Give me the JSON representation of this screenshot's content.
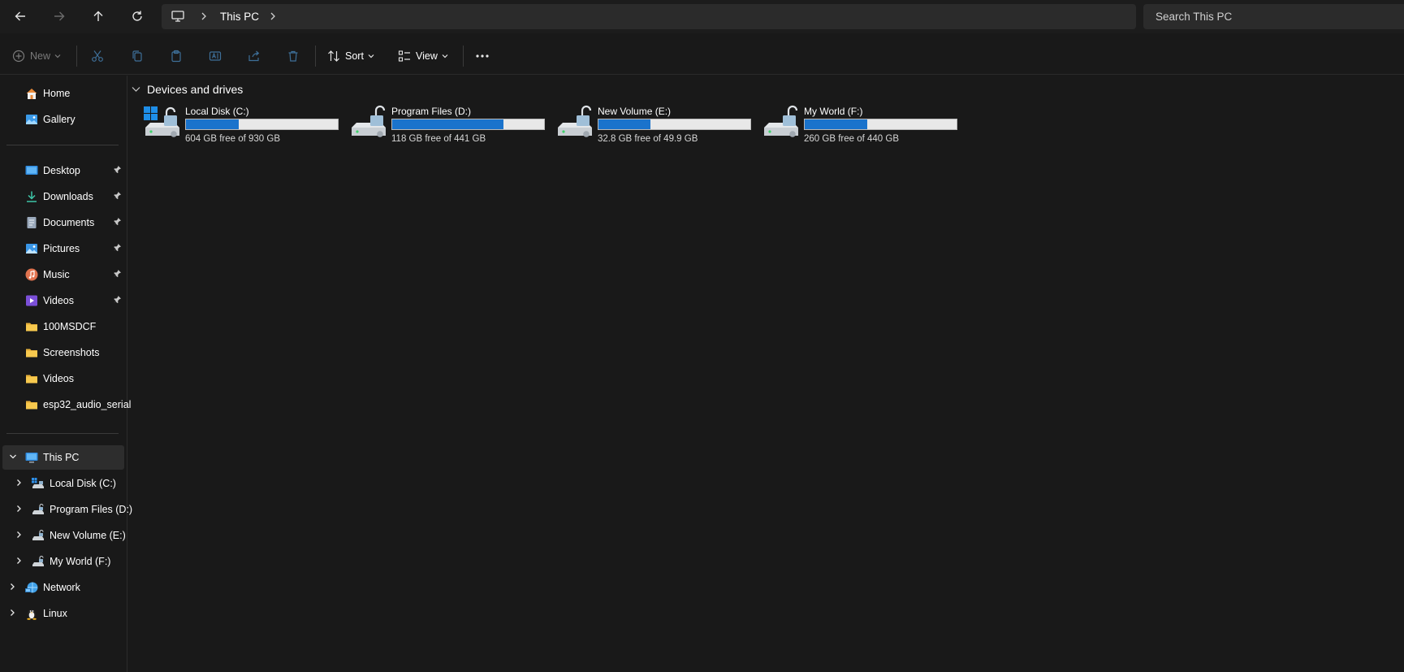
{
  "address": {
    "crumb": "This PC",
    "search_placeholder": "Search This PC"
  },
  "toolbar": {
    "new_label": "New",
    "sort_label": "Sort",
    "view_label": "View"
  },
  "sidebar": {
    "quick": [
      {
        "label": "Home",
        "icon": "home-icon"
      },
      {
        "label": "Gallery",
        "icon": "gallery-icon"
      }
    ],
    "pinned": [
      {
        "label": "Desktop",
        "icon": "desktop-icon"
      },
      {
        "label": "Downloads",
        "icon": "download-icon"
      },
      {
        "label": "Documents",
        "icon": "document-icon"
      },
      {
        "label": "Pictures",
        "icon": "pictures-icon"
      },
      {
        "label": "Music",
        "icon": "music-icon"
      },
      {
        "label": "Videos",
        "icon": "videos-icon"
      }
    ],
    "folders": [
      {
        "label": "100MSDCF",
        "icon": "folder-icon"
      },
      {
        "label": "Screenshots",
        "icon": "folder-icon"
      },
      {
        "label": "Videos",
        "icon": "folder-icon"
      },
      {
        "label": "esp32_audio_serial",
        "icon": "folder-icon"
      }
    ],
    "this_pc": {
      "label": "This PC",
      "icon": "computer-icon"
    },
    "drives": [
      {
        "label": "Local Disk (C:)"
      },
      {
        "label": "Program Files (D:)"
      },
      {
        "label": "New Volume (E:)"
      },
      {
        "label": "My World (F:)"
      }
    ],
    "network": {
      "label": "Network",
      "icon": "network-icon"
    },
    "linux": {
      "label": "Linux",
      "icon": "linux-icon"
    }
  },
  "content": {
    "section_title": "Devices and drives",
    "drives": [
      {
        "name": "Local Disk (C:)",
        "free_text": "604 GB free of 930 GB",
        "used_fraction": 0.35
      },
      {
        "name": "Program Files (D:)",
        "free_text": "118 GB free of 441 GB",
        "used_fraction": 0.73
      },
      {
        "name": "New Volume (E:)",
        "free_text": "32.8 GB free of 49.9 GB",
        "used_fraction": 0.34
      },
      {
        "name": "My World (F:)",
        "free_text": "260 GB free of 440 GB",
        "used_fraction": 0.41
      }
    ]
  },
  "colors": {
    "background": "#191919",
    "bar_fill": "#1a73cc",
    "bar_track": "#e8e8e8"
  }
}
